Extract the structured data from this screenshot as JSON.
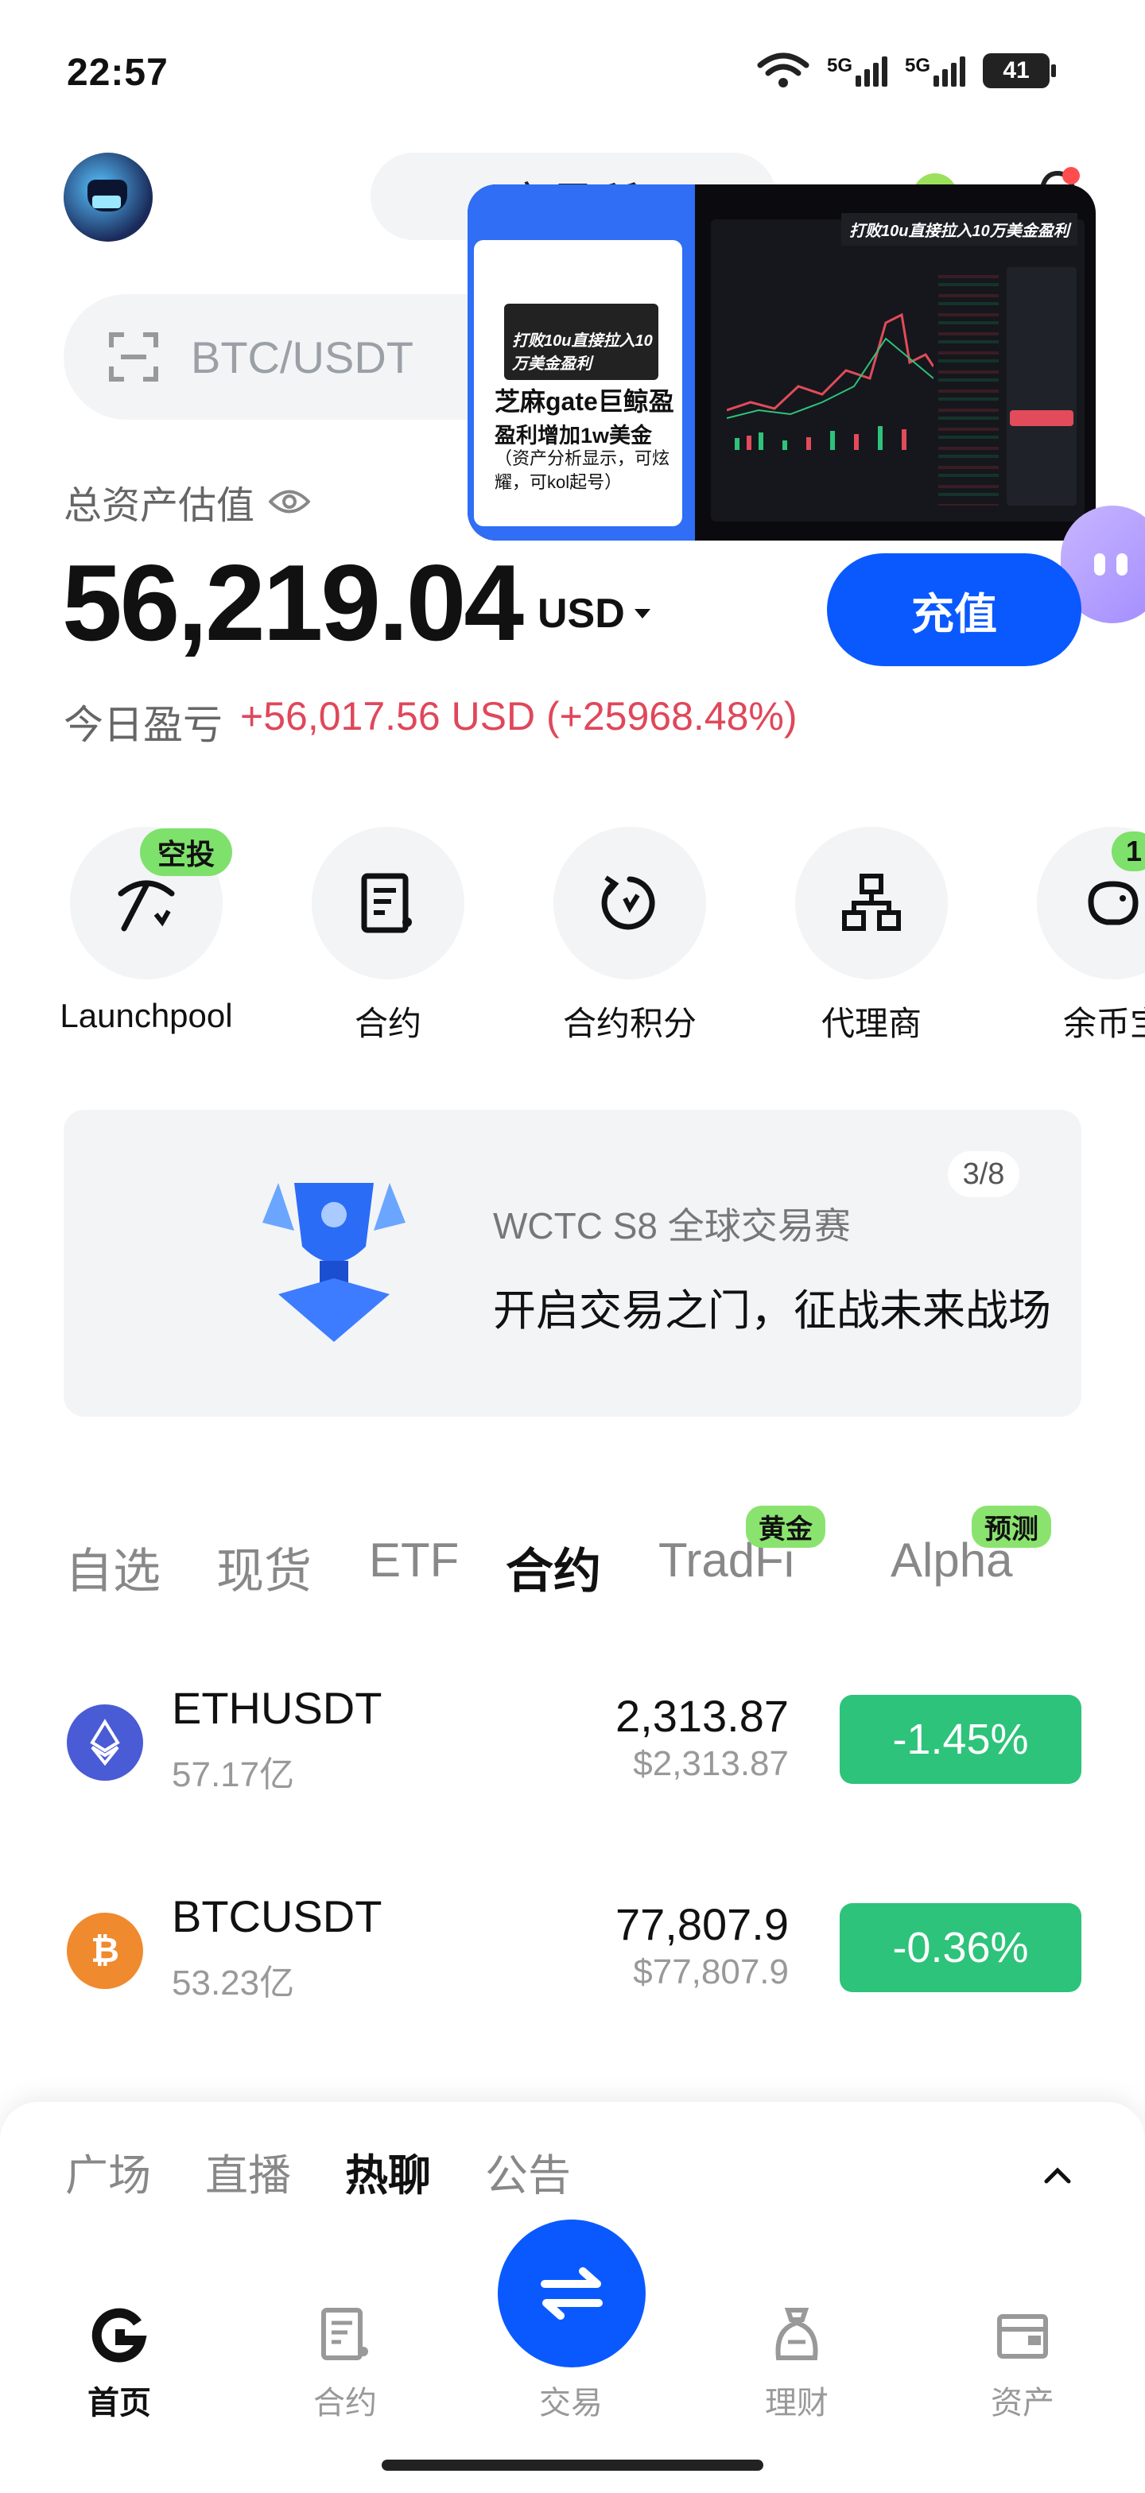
{
  "status_bar": {
    "time": "22:57",
    "net1": "5G",
    "net2": "5G",
    "battery": "41"
  },
  "header": {
    "pill_text": "交易所",
    "search_placeholder": "BTC/USDT"
  },
  "floating_video": {
    "caption": "打败10u直接拉入10万美金盈利",
    "headline": "芝麻gate巨鲸盈",
    "subline": "盈利增加1w美金",
    "note": "（资产分析显示，可炫耀，可kol起号）"
  },
  "balance": {
    "label": "总资产估值",
    "amount": "56,219.04",
    "currency": "USD",
    "deposit_label": "充值",
    "pnl_label": "今日盈亏",
    "pnl_value": "+56,017.56 USD (+25968.48%)"
  },
  "shortcuts": [
    {
      "label": "Launchpool",
      "badge": "空投",
      "icon": "pickaxe-icon"
    },
    {
      "label": "合约",
      "icon": "contract-icon"
    },
    {
      "label": "合约积分",
      "icon": "points-icon"
    },
    {
      "label": "代理商",
      "icon": "agent-icon"
    },
    {
      "label": "余币宝",
      "badge": "1",
      "icon": "piggy-icon"
    }
  ],
  "banner": {
    "page": "3/8",
    "subtitle": "WCTC S8 全球交易赛",
    "title": "开启交易之门，征战未来战场"
  },
  "market_tabs": [
    {
      "label": "自选"
    },
    {
      "label": "现货"
    },
    {
      "label": "ETF"
    },
    {
      "label": "合约",
      "active": true
    },
    {
      "label": "TradFi",
      "badge": "黄金"
    },
    {
      "label": "Alpha",
      "badge": "预测"
    }
  ],
  "market_rows": [
    {
      "symbol": "ETHUSDT",
      "volume": "57.17亿",
      "price": "2,313.87",
      "price_usd": "$2,313.87",
      "change": "-1.45%",
      "coin_color": "#4a5bd6",
      "icon": "eth-icon"
    },
    {
      "symbol": "BTCUSDT",
      "volume": "53.23亿",
      "price": "77,807.9",
      "price_usd": "$77,807.9",
      "change": "-0.36%",
      "coin_color": "#f08a2e",
      "icon": "btc-icon"
    }
  ],
  "feed_tabs": [
    {
      "label": "广场"
    },
    {
      "label": "直播"
    },
    {
      "label": "热聊",
      "active": true
    },
    {
      "label": "公告"
    }
  ],
  "bottom_nav": [
    {
      "label": "首页",
      "icon": "home-icon",
      "active": true
    },
    {
      "label": "合约",
      "icon": "contract-icon"
    },
    {
      "label": "交易",
      "icon": "swap-icon"
    },
    {
      "label": "理财",
      "icon": "finance-icon"
    },
    {
      "label": "资产",
      "icon": "wallet-icon"
    }
  ],
  "colors": {
    "accent": "#0a59ff",
    "positive_change": "#2dc37a",
    "pnl": "#e0475a"
  }
}
